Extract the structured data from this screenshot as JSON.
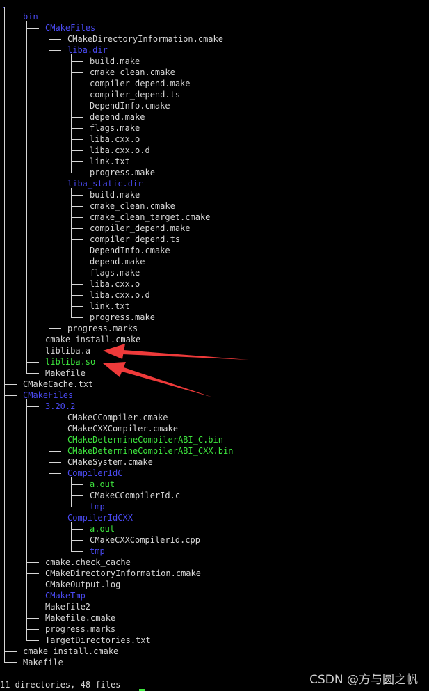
{
  "root": ".",
  "tree": [
    {
      "depth": 0,
      "name": "bin",
      "type": "dir",
      "last": false
    },
    {
      "depth": 1,
      "name": "CMakeFiles",
      "type": "dir",
      "last": false
    },
    {
      "depth": 2,
      "name": "CMakeDirectoryInformation.cmake",
      "type": "file",
      "last": false
    },
    {
      "depth": 2,
      "name": "liba.dir",
      "type": "dir",
      "last": false
    },
    {
      "depth": 3,
      "name": "build.make",
      "type": "file",
      "last": false
    },
    {
      "depth": 3,
      "name": "cmake_clean.cmake",
      "type": "file",
      "last": false
    },
    {
      "depth": 3,
      "name": "compiler_depend.make",
      "type": "file",
      "last": false
    },
    {
      "depth": 3,
      "name": "compiler_depend.ts",
      "type": "file",
      "last": false
    },
    {
      "depth": 3,
      "name": "DependInfo.cmake",
      "type": "file",
      "last": false
    },
    {
      "depth": 3,
      "name": "depend.make",
      "type": "file",
      "last": false
    },
    {
      "depth": 3,
      "name": "flags.make",
      "type": "file",
      "last": false
    },
    {
      "depth": 3,
      "name": "liba.cxx.o",
      "type": "file",
      "last": false
    },
    {
      "depth": 3,
      "name": "liba.cxx.o.d",
      "type": "file",
      "last": false
    },
    {
      "depth": 3,
      "name": "link.txt",
      "type": "file",
      "last": false
    },
    {
      "depth": 3,
      "name": "progress.make",
      "type": "file",
      "last": true
    },
    {
      "depth": 2,
      "name": "liba_static.dir",
      "type": "dir",
      "last": false
    },
    {
      "depth": 3,
      "name": "build.make",
      "type": "file",
      "last": false
    },
    {
      "depth": 3,
      "name": "cmake_clean.cmake",
      "type": "file",
      "last": false
    },
    {
      "depth": 3,
      "name": "cmake_clean_target.cmake",
      "type": "file",
      "last": false
    },
    {
      "depth": 3,
      "name": "compiler_depend.make",
      "type": "file",
      "last": false
    },
    {
      "depth": 3,
      "name": "compiler_depend.ts",
      "type": "file",
      "last": false
    },
    {
      "depth": 3,
      "name": "DependInfo.cmake",
      "type": "file",
      "last": false
    },
    {
      "depth": 3,
      "name": "depend.make",
      "type": "file",
      "last": false
    },
    {
      "depth": 3,
      "name": "flags.make",
      "type": "file",
      "last": false
    },
    {
      "depth": 3,
      "name": "liba.cxx.o",
      "type": "file",
      "last": false
    },
    {
      "depth": 3,
      "name": "liba.cxx.o.d",
      "type": "file",
      "last": false
    },
    {
      "depth": 3,
      "name": "link.txt",
      "type": "file",
      "last": false
    },
    {
      "depth": 3,
      "name": "progress.make",
      "type": "file",
      "last": true
    },
    {
      "depth": 2,
      "name": "progress.marks",
      "type": "file",
      "last": true
    },
    {
      "depth": 1,
      "name": "cmake_install.cmake",
      "type": "file",
      "last": false
    },
    {
      "depth": 1,
      "name": "libliba.a",
      "type": "file",
      "last": false
    },
    {
      "depth": 1,
      "name": "libliba.so",
      "type": "exec",
      "last": false
    },
    {
      "depth": 1,
      "name": "Makefile",
      "type": "file",
      "last": true
    },
    {
      "depth": 0,
      "name": "CMakeCache.txt",
      "type": "file",
      "last": false
    },
    {
      "depth": 0,
      "name": "CMakeFiles",
      "type": "dir",
      "last": false
    },
    {
      "depth": 1,
      "name": "3.20.2",
      "type": "dir",
      "last": false
    },
    {
      "depth": 2,
      "name": "CMakeCCompiler.cmake",
      "type": "file",
      "last": false
    },
    {
      "depth": 2,
      "name": "CMakeCXXCompiler.cmake",
      "type": "file",
      "last": false
    },
    {
      "depth": 2,
      "name": "CMakeDetermineCompilerABI_C.bin",
      "type": "exec",
      "last": false
    },
    {
      "depth": 2,
      "name": "CMakeDetermineCompilerABI_CXX.bin",
      "type": "exec",
      "last": false
    },
    {
      "depth": 2,
      "name": "CMakeSystem.cmake",
      "type": "file",
      "last": false
    },
    {
      "depth": 2,
      "name": "CompilerIdC",
      "type": "dir",
      "last": false
    },
    {
      "depth": 3,
      "name": "a.out",
      "type": "exec",
      "last": false
    },
    {
      "depth": 3,
      "name": "CMakeCCompilerId.c",
      "type": "file",
      "last": false
    },
    {
      "depth": 3,
      "name": "tmp",
      "type": "dir",
      "last": true
    },
    {
      "depth": 2,
      "name": "CompilerIdCXX",
      "type": "dir",
      "last": true
    },
    {
      "depth": 3,
      "name": "a.out",
      "type": "exec",
      "last": false
    },
    {
      "depth": 3,
      "name": "CMakeCXXCompilerId.cpp",
      "type": "file",
      "last": false
    },
    {
      "depth": 3,
      "name": "tmp",
      "type": "dir",
      "last": true
    },
    {
      "depth": 1,
      "name": "cmake.check_cache",
      "type": "file",
      "last": false
    },
    {
      "depth": 1,
      "name": "CMakeDirectoryInformation.cmake",
      "type": "file",
      "last": false
    },
    {
      "depth": 1,
      "name": "CMakeOutput.log",
      "type": "file",
      "last": false
    },
    {
      "depth": 1,
      "name": "CMakeTmp",
      "type": "dir",
      "last": false
    },
    {
      "depth": 1,
      "name": "Makefile2",
      "type": "file",
      "last": false
    },
    {
      "depth": 1,
      "name": "Makefile.cmake",
      "type": "file",
      "last": false
    },
    {
      "depth": 1,
      "name": "progress.marks",
      "type": "file",
      "last": false
    },
    {
      "depth": 1,
      "name": "TargetDirectories.txt",
      "type": "file",
      "last": true
    },
    {
      "depth": 0,
      "name": "cmake_install.cmake",
      "type": "file",
      "last": false
    },
    {
      "depth": 0,
      "name": "Makefile",
      "type": "file",
      "last": true
    }
  ],
  "summary": "11 directories, 48 files",
  "watermark": "CSDN @方与圆之帆",
  "colors": {
    "background": "#000000",
    "text": "#d6d6d6",
    "directory": "#4a4af2",
    "executable": "#3ee63e",
    "annotation_arrow": "#ee3a3a"
  }
}
